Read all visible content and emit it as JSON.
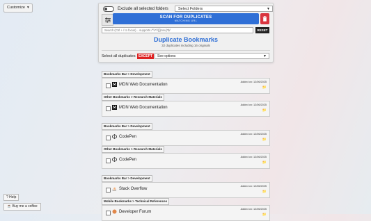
{
  "top": {
    "customize_label": "Customize",
    "customize_caret": "▾"
  },
  "panel": {
    "exclude_label": "Exclude all selected folders",
    "select_folders": "Select Folders",
    "scan_title": "SCAN FOR DUPLICATES",
    "scan_subtitle": "MATCHING URL",
    "search_placeholder": "Search (Ctrl + / to focus)... supports /^\\/*\\/([]msu]*$/",
    "reset_label": "RESET",
    "title": "Duplicate Bookmarks",
    "subtitle": "32 duplicates including 16 originals",
    "select_all_label": "Select all duplicates",
    "except_label": "EXCEPT",
    "see_options": "See options"
  },
  "groups": [
    {
      "label": "Bookmarks Bar > Development",
      "title": "MDN Web Documentation",
      "added": "Added on: 12/06/2025",
      "icon": "mdn-icon"
    },
    {
      "label": "Other Bookmarks > Research Materials",
      "title": "MDN Web Documentation",
      "added": "Added on: 12/06/2025",
      "icon": "mdn-icon"
    },
    {
      "label": "Bookmarks Bar > Development",
      "title": "CodePen",
      "added": "Added on: 12/06/2025",
      "icon": "codepen-icon"
    },
    {
      "label": "Other Bookmarks > Research Materials",
      "title": "CodePen",
      "added": "Added on: 12/06/2025",
      "icon": "codepen-icon"
    },
    {
      "label": "Bookmarks Bar > Development",
      "title": "Stack Overflow",
      "added": "Added on: 12/06/2025",
      "icon": "stackoverflow-icon"
    },
    {
      "label": "Mobile Bookmarks > Technical References",
      "title": "Developer Forum",
      "added": "Added on: 12/06/2025",
      "icon": "developer-icon"
    }
  ],
  "footer": {
    "help_label": "? Help",
    "coffee_label": "Buy me a coffee"
  },
  "colors": {
    "accent": "#2f6fd6",
    "danger": "#d9343f",
    "folder": "#e2b21d"
  }
}
